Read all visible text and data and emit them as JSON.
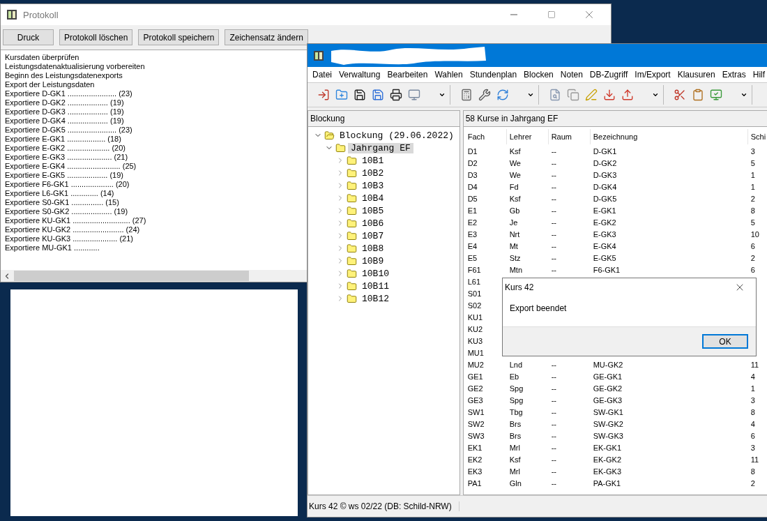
{
  "protokoll_window": {
    "title": "Protokoll",
    "buttons": [
      "Druck",
      "Protokoll löschen",
      "Protokoll speichern",
      "Zeichensatz ändern"
    ],
    "log_lines": [
      "Kursdaten überprüfen",
      "Leistungsdatenaktualisierung vorbereiten",
      "Beginn des Leistungsdatenexports",
      "Export der Leistungsdaten",
      "Exportiere D-GK1 ....................... (23)",
      "Exportiere D-GK2 ................... (19)",
      "Exportiere D-GK3 ................... (19)",
      "Exportiere D-GK4 ................... (19)",
      "Exportiere D-GK5 ....................... (23)",
      "Exportiere E-GK1 .................. (18)",
      "Exportiere E-GK2 .................... (20)",
      "Exportiere E-GK3 ..................... (21)",
      "Exportiere E-GK4 ......................... (25)",
      "Exportiere E-GK5 ................... (19)",
      "Exportiere F6-GK1 .................... (20)",
      "Exportiere L6-GK1 ............. (14)",
      "Exportiere S0-GK1 ............... (15)",
      "Exportiere S0-GK2 ................... (19)",
      "Exportiere KU-GK1 ........................... (27)",
      "Exportiere KU-GK2 ........................ (24)",
      "Exportiere KU-GK3 ..................... (21)",
      "Exportiere MU-GK1 ............"
    ]
  },
  "main_window": {
    "menu": [
      "Datei",
      "Verwaltung",
      "Bearbeiten",
      "Wahlen",
      "Stundenplan",
      "Blocken",
      "Noten",
      "DB-Zugriff",
      "Im/Export",
      "Klausuren",
      "Extras",
      "Hilf"
    ],
    "tree_panel": {
      "header": "Blockung",
      "tree": [
        {
          "label": "Blockung (29.06.2022)",
          "expanded": true,
          "selected": false,
          "children": [
            {
              "label": "Jahrgang EF",
              "expanded": true,
              "selected": true,
              "children": [
                {
                  "label": "10B1",
                  "expanded": false,
                  "selected": false
                },
                {
                  "label": "10B2",
                  "expanded": false,
                  "selected": false
                },
                {
                  "label": "10B3",
                  "expanded": false,
                  "selected": false
                },
                {
                  "label": "10B4",
                  "expanded": false,
                  "selected": false
                },
                {
                  "label": "10B5",
                  "expanded": false,
                  "selected": false
                },
                {
                  "label": "10B6",
                  "expanded": false,
                  "selected": false
                },
                {
                  "label": "10B7",
                  "expanded": false,
                  "selected": false
                },
                {
                  "label": "10B8",
                  "expanded": false,
                  "selected": false
                },
                {
                  "label": "10B9",
                  "expanded": false,
                  "selected": false
                },
                {
                  "label": "10B10",
                  "expanded": false,
                  "selected": false
                },
                {
                  "label": "10B11",
                  "expanded": false,
                  "selected": false
                },
                {
                  "label": "10B12",
                  "expanded": false,
                  "selected": false
                }
              ]
            }
          ]
        }
      ]
    },
    "course_panel": {
      "header": "58 Kurse in Jahrgang EF",
      "columns": [
        "Fach",
        "Lehrer",
        "Raum",
        "Bezeichnung",
        "Schi"
      ],
      "rows": [
        {
          "cells": [
            "D1",
            "Ksf",
            "--",
            "D-GK1",
            "3"
          ]
        },
        {
          "cells": [
            "D2",
            "We",
            "--",
            "D-GK2",
            "5"
          ]
        },
        {
          "cells": [
            "D3",
            "We",
            "--",
            "D-GK3",
            "1"
          ]
        },
        {
          "cells": [
            "D4",
            "Fd",
            "--",
            "D-GK4",
            "1"
          ]
        },
        {
          "cells": [
            "D5",
            "Ksf",
            "--",
            "D-GK5",
            "2"
          ]
        },
        {
          "cells": [
            "E1",
            "Gb",
            "--",
            "E-GK1",
            "8"
          ]
        },
        {
          "cells": [
            "E2",
            "Je",
            "--",
            "E-GK2",
            "5"
          ]
        },
        {
          "cells": [
            "E3",
            "Nrt",
            "--",
            "E-GK3",
            "10"
          ]
        },
        {
          "cells": [
            "E4",
            "Mt",
            "--",
            "E-GK4",
            "6"
          ]
        },
        {
          "cells": [
            "E5",
            "Stz",
            "--",
            "E-GK5",
            "2"
          ]
        },
        {
          "cells": [
            "F61",
            "Mtn",
            "--",
            "F6-GK1",
            "6"
          ]
        },
        {
          "cells": [
            "L61"
          ]
        },
        {
          "cells": [
            "S01"
          ]
        },
        {
          "cells": [
            "S02"
          ]
        },
        {
          "cells": [
            "KU1"
          ]
        },
        {
          "cells": [
            "KU2"
          ]
        },
        {
          "cells": [
            "KU3"
          ]
        },
        {
          "cells": [
            "MU1"
          ]
        },
        {
          "cells": [
            "MU2",
            "Lnd",
            "--",
            "MU-GK2",
            "11"
          ]
        },
        {
          "cells": [
            "GE1",
            "Eb",
            "--",
            "GE-GK1",
            "4"
          ]
        },
        {
          "cells": [
            "GE2",
            "Spg",
            "--",
            "GE-GK2",
            "1"
          ]
        },
        {
          "cells": [
            "GE3",
            "Spg",
            "--",
            "GE-GK3",
            "3"
          ]
        },
        {
          "cells": [
            "SW1",
            "Tbg",
            "--",
            "SW-GK1",
            "8"
          ]
        },
        {
          "cells": [
            "SW2",
            "Brs",
            "--",
            "SW-GK2",
            "4"
          ]
        },
        {
          "cells": [
            "SW3",
            "Brs",
            "--",
            "SW-GK3",
            "6"
          ]
        },
        {
          "cells": [
            "EK1",
            "Mrl",
            "--",
            "EK-GK1",
            "3"
          ]
        },
        {
          "cells": [
            "EK2",
            "Ksf",
            "--",
            "EK-GK2",
            "11"
          ]
        },
        {
          "cells": [
            "EK3",
            "Mrl",
            "--",
            "EK-GK3",
            "8"
          ]
        },
        {
          "cells": [
            "PA1",
            "Gln",
            "--",
            "PA-GK1",
            "2"
          ]
        }
      ]
    },
    "status_bar": "Kurs 42 © ws 02/22 (DB: Schild-NRW)"
  },
  "dialog": {
    "title": "Kurs 42",
    "message": "Export beendet",
    "button": "OK"
  }
}
